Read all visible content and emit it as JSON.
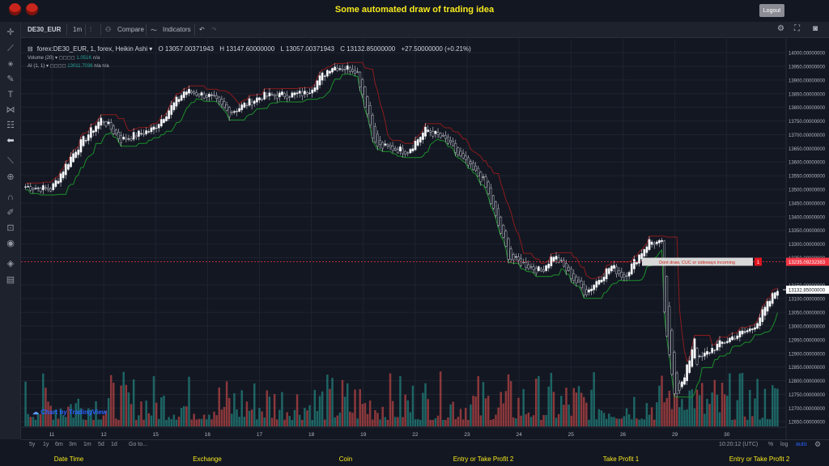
{
  "header": {
    "title": "Some automated draw of trading idea",
    "logout_label": "Logout"
  },
  "toolbar": {
    "symbol": "DE30_EUR",
    "interval": "1m",
    "compare_label": "Compare",
    "indicators_label": "Indicators"
  },
  "legend": {
    "symbol_text": "forex:DE30_EUR, 1, forex, Heikin Ashi",
    "open": "O 13057.00371943",
    "high": "H 13147.60000000",
    "low": "L 13057.00371943",
    "close": "C 13132.85000000",
    "change": "+27.50000000 (+0.21%)",
    "volume_label": "Volume (20)",
    "volume_value": "1.051K",
    "volume_na": "n/a",
    "ai_label": "AI (1, 1)",
    "ai_value": "13011.7036",
    "ai_na1": "n/a",
    "ai_na2": "n/a"
  },
  "watermark": "Chart by TradingView",
  "annotation": {
    "text": "Dont draw, CUC or sideways incoming",
    "badge": "1"
  },
  "price_tags": {
    "line_price": "13235.09232383",
    "last_price": "13132.85000000"
  },
  "bottombar": {
    "ranges": [
      "5y",
      "1y",
      "6m",
      "3m",
      "1m",
      "5d",
      "1d"
    ],
    "goto": "Go to...",
    "time": "10:20:12 (UTC)",
    "percent": "%",
    "log": "log",
    "auto": "auto"
  },
  "footer": {
    "columns": [
      "Date Time",
      "Exchange",
      "Coin",
      "Entry or Take Profit 2",
      "Take Profit 1",
      "Entry or Take Profit 2"
    ]
  },
  "colors": {
    "up": "#26a69a",
    "down": "#ef5350",
    "accent_line": "#f23645",
    "ai_green": "#1b8f2a",
    "ai_red": "#8b1c1c"
  },
  "chart_data": {
    "type": "candlestick",
    "style": "Heikin Ashi",
    "symbol": "DE30_EUR",
    "x_tick_labels": [
      "11",
      "12",
      "15",
      "16",
      "17",
      "18",
      "19",
      "22",
      "23",
      "24",
      "25",
      "26",
      "29",
      "30"
    ],
    "y_tick_labels": [
      "14000.00000000",
      "13950.00000000",
      "13900.00000000",
      "13850.00000000",
      "13800.00000000",
      "13750.00000000",
      "13700.00000000",
      "13650.00000000",
      "13600.00000000",
      "13550.00000000",
      "13500.00000000",
      "13450.00000000",
      "13400.00000000",
      "13350.00000000",
      "13300.00000000",
      "13250.00000000",
      "13150.00000000",
      "13100.00000000",
      "13050.00000000",
      "13000.00000000",
      "12950.00000000",
      "12900.00000000",
      "12850.00000000",
      "12800.00000000",
      "12750.00000000",
      "12700.00000000",
      "12650.00000000"
    ],
    "ylim": [
      12630,
      14015
    ],
    "price_path_x": [
      0,
      4,
      8,
      12,
      15,
      20,
      25,
      29,
      32,
      37,
      44,
      48,
      52,
      55,
      60,
      63,
      66,
      69,
      72,
      76,
      81,
      83,
      88,
      92,
      94,
      98,
      100
    ],
    "price_path_y": [
      13510,
      13500,
      13650,
      13760,
      13680,
      13720,
      13860,
      13840,
      13780,
      13840,
      13850,
      13950,
      13940,
      13660,
      13640,
      13720,
      13680,
      13600,
      13530,
      13250,
      13200,
      13260,
      13120,
      13220,
      13180,
      13310,
      13300
    ],
    "drop_path_x": [
      0,
      0.35,
      0.7,
      1.5,
      2.5,
      3.3,
      4
    ],
    "drop_path_y": [
      13300,
      13000,
      12920,
      12750,
      12800,
      12900,
      13000
    ],
    "rally_path_x": [
      0,
      0.5,
      1.1,
      1.7,
      2.1,
      2.5
    ],
    "rally_path_y": [
      12870,
      12920,
      12960,
      12990,
      13060,
      13140
    ],
    "horizontal_line": 13235.09,
    "last_price": 13132.85
  }
}
